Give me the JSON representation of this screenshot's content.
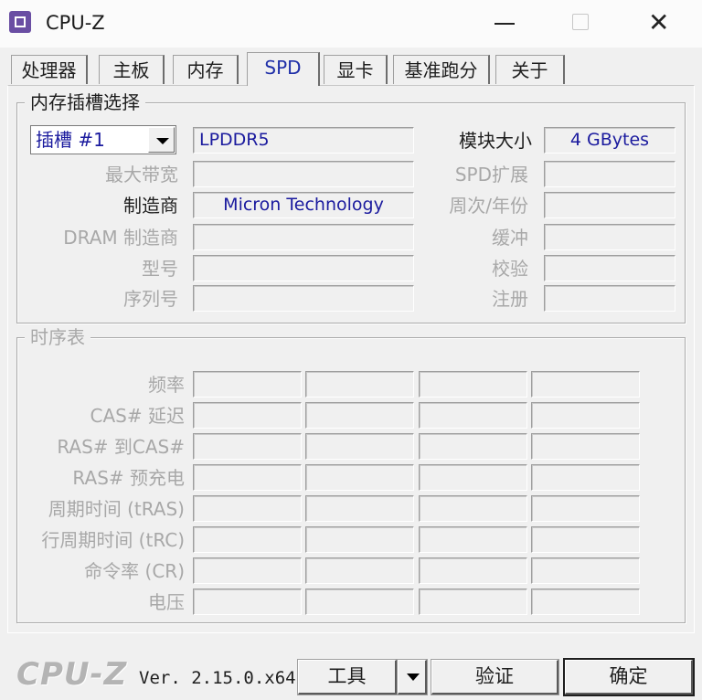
{
  "window": {
    "title": "CPU-Z",
    "controls": {
      "minimize": "—",
      "maximize": "☐",
      "close": "✕"
    }
  },
  "tabs": [
    {
      "label": "处理器",
      "active": false
    },
    {
      "label": "主板",
      "active": false
    },
    {
      "label": "内存",
      "active": false
    },
    {
      "label": "SPD",
      "active": true
    },
    {
      "label": "显卡",
      "active": false
    },
    {
      "label": "基准跑分",
      "active": false
    },
    {
      "label": "关于",
      "active": false
    }
  ],
  "slot_group": {
    "title": "内存插槽选择",
    "slot_select": "插槽 #1",
    "memory_type": "LPDDR5",
    "module_size_label": "模块大小",
    "module_size": "4 GBytes",
    "max_bandwidth_label": "最大带宽",
    "max_bandwidth": "",
    "spd_ext_label": "SPD扩展",
    "spd_ext": "",
    "manufacturer_label": "制造商",
    "manufacturer": "Micron Technology",
    "week_year_label": "周次/年份",
    "week_year": "",
    "dram_manufacturer_label": "DRAM 制造商",
    "dram_manufacturer": "",
    "buffered_label": "缓冲",
    "buffered": "",
    "part_number_label": "型号",
    "part_number": "",
    "correction_label": "校验",
    "correction": "",
    "serial_label": "序列号",
    "serial": "",
    "registered_label": "注册",
    "registered": ""
  },
  "timings_group": {
    "title": "时序表",
    "rows": [
      {
        "label": "频率"
      },
      {
        "label": "CAS# 延迟"
      },
      {
        "label": "RAS# 到CAS#"
      },
      {
        "label": "RAS# 预充电"
      },
      {
        "label": "周期时间 (tRAS)"
      },
      {
        "label": "行周期时间 (tRC)"
      },
      {
        "label": "命令率 (CR)"
      },
      {
        "label": "电压"
      }
    ]
  },
  "footer": {
    "logo": "CPU-Z",
    "version": "Ver. 2.15.0.x64",
    "tools_button": "工具",
    "validate_button": "验证",
    "ok_button": "确定"
  },
  "colors": {
    "accent_text": "#1a1a9e",
    "disabled_label": "#a8a8a8",
    "background": "#f0f0f0"
  }
}
